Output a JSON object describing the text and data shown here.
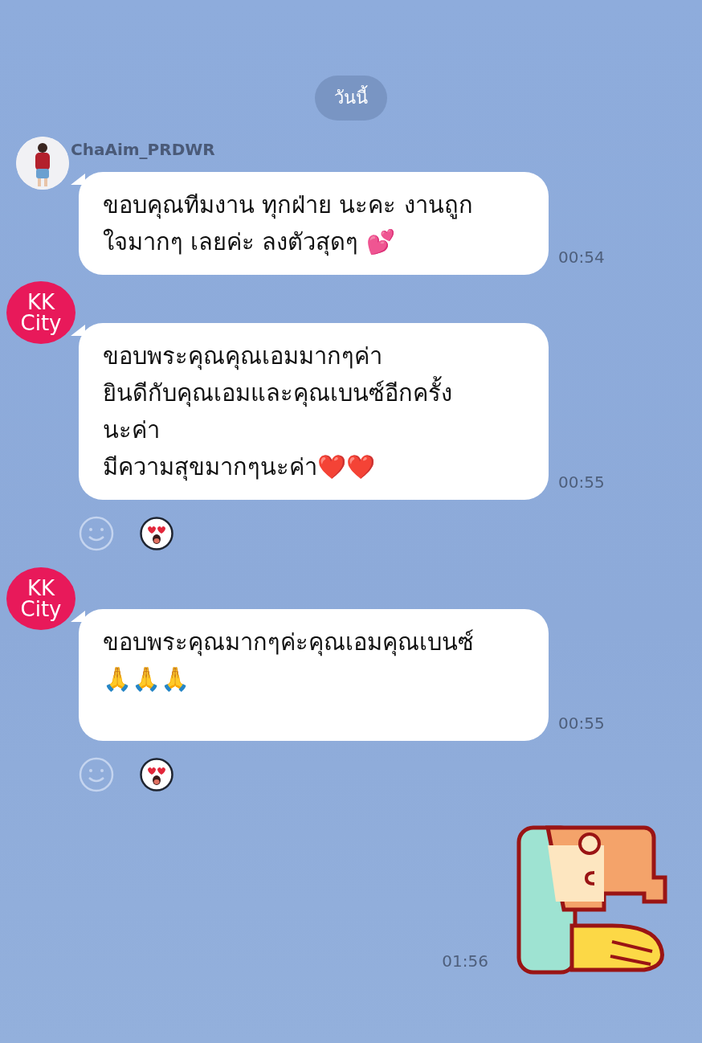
{
  "date_divider": "วันนี้",
  "messages": [
    {
      "kind": "text",
      "sender": {
        "name": "ChaAim_PRDWR",
        "avatar": {
          "kind": "photo"
        }
      },
      "lines": [
        "ขอบคุณทีมงาน ทุกฝ่าย นะคะ งานถูก",
        "ใจมากๆ เลยค่ะ ลงตัวสุดๆ 💕"
      ],
      "time": "00:54",
      "reacted": false
    },
    {
      "kind": "text",
      "sender": {
        "avatar": {
          "kind": "logo",
          "text": [
            "KK",
            "City"
          ]
        }
      },
      "lines": [
        "ขอบพระคุณคุณเอมมากๆค่า",
        "ยินดีกับคุณเอมและคุณเบนซ์อีกครั้ง",
        "นะค่า",
        "มีความสุขมากๆนะค่า❤️❤️"
      ],
      "time": "00:55",
      "reacted": true
    },
    {
      "kind": "text",
      "sender": {
        "avatar": {
          "kind": "logo",
          "text": [
            "KK",
            "City"
          ]
        }
      },
      "lines": [
        "ขอบพระคุณมากๆค่ะคุณเอมคุณเบนซ์",
        "🙏🙏🙏"
      ],
      "time": "00:55",
      "reacted": true
    },
    {
      "kind": "sticker",
      "time": "01:56"
    }
  ]
}
